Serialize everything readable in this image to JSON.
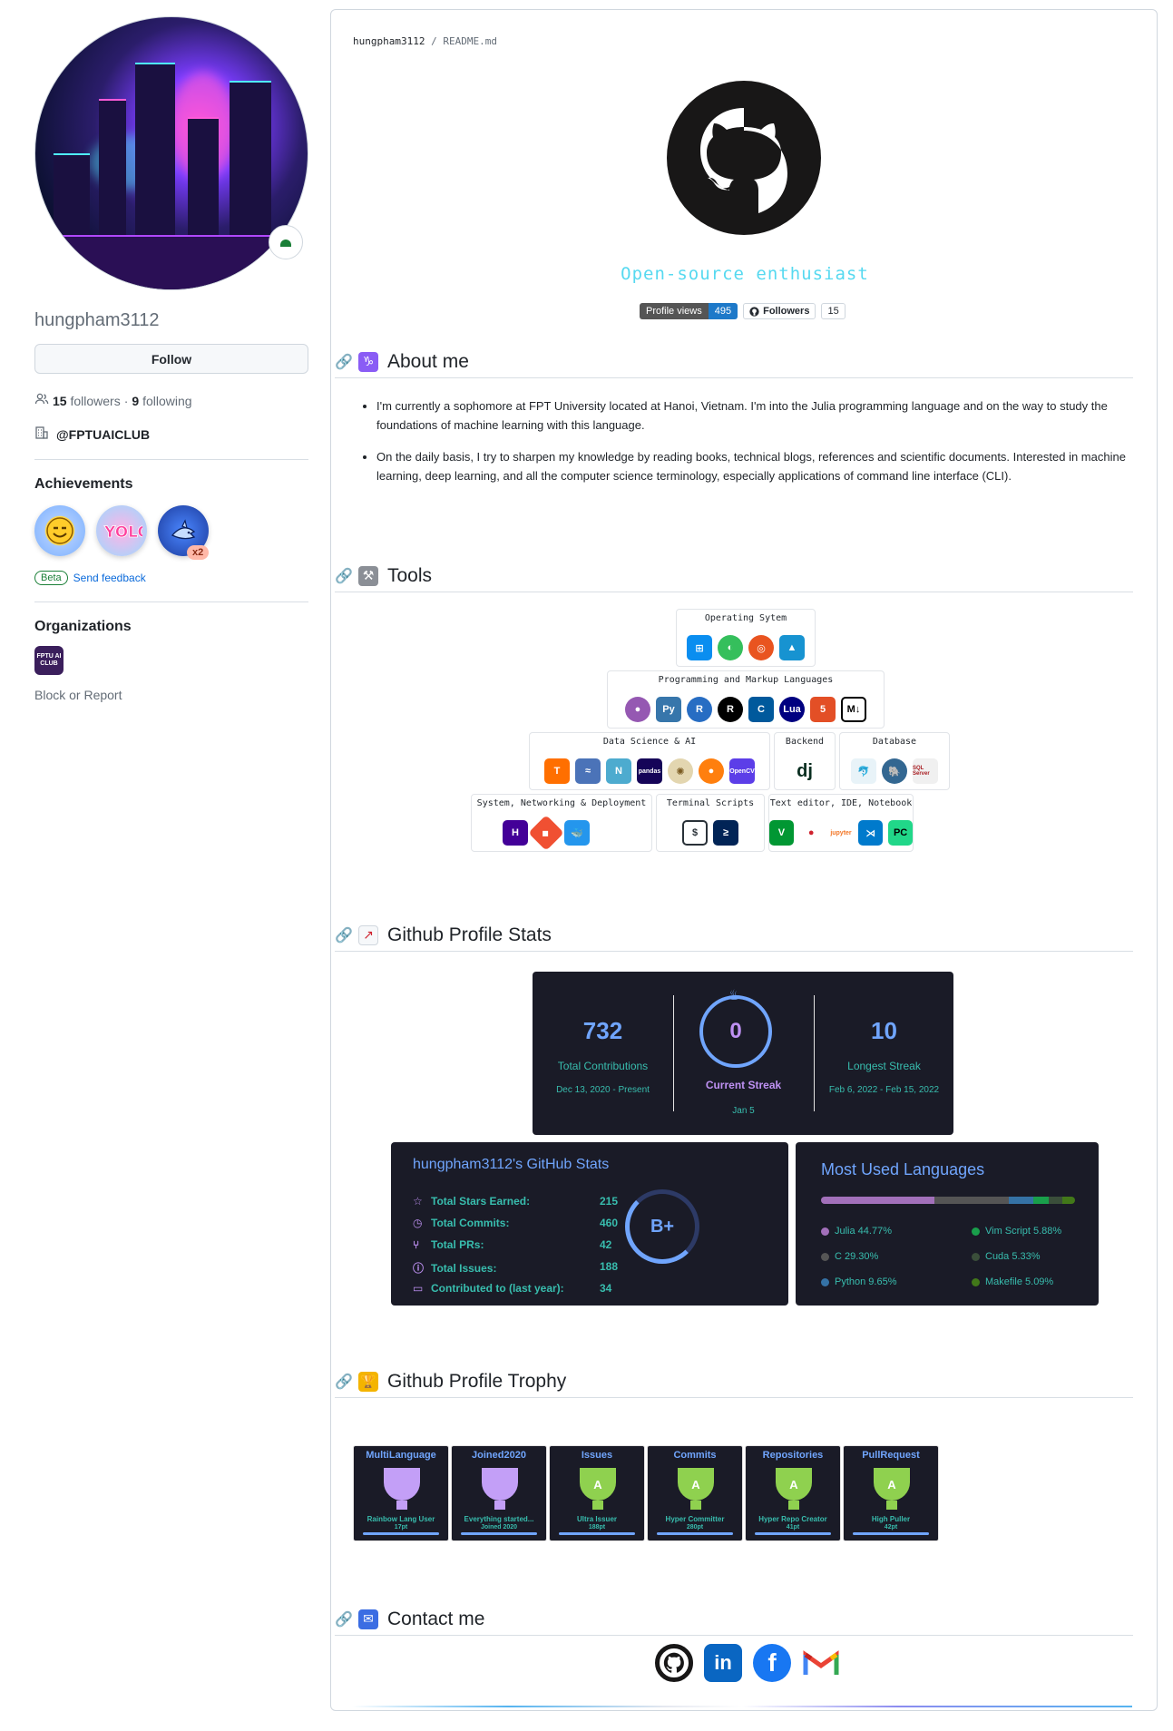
{
  "sidebar": {
    "username": "hungpham3112",
    "follow_label": "Follow",
    "followers_count": "15",
    "followers_label": "followers",
    "following_count": "9",
    "following_label": "following",
    "organization_handle": "@FPTUAICLUB",
    "achievements_title": "Achievements",
    "achievement_multiplier": "x2",
    "beta_label": "Beta",
    "feedback_label": "Send feedback",
    "organizations_title": "Organizations",
    "org_logo_text": "FPTU AI CLUB",
    "block_label": "Block or Report"
  },
  "readme": {
    "breadcrumb_user": "hungpham3112",
    "breadcrumb_sep": " / ",
    "breadcrumb_file": "README.md",
    "tagline": "Open-source enthusiast",
    "profile_views_label": "Profile views",
    "profile_views_value": "495",
    "followers_badge_label": "Followers",
    "followers_badge_value": "15"
  },
  "sections": {
    "about_title": "About me",
    "about_items": [
      "I'm currently a sophomore at FPT University located at Hanoi, Vietnam. I'm into the Julia programming language and on the way to study the foundations of machine learning with this language.",
      "On the daily basis, I try to sharpen my knowledge by reading books, technical blogs, references and scientific documents. Interested in machine learning, deep learning, and all the computer science terminology, especially applications of command line interface (CLI)."
    ],
    "tools_title": "Tools",
    "stats_title": "Github Profile Stats",
    "trophy_title": "Github Profile Trophy",
    "contact_title": "Contact me"
  },
  "tools": {
    "os": "Operating Sytem",
    "langs": "Programming and Markup Languages",
    "ds": "Data Science & AI",
    "backend": "Backend",
    "database": "Database",
    "sys": "System, Networking & Deployment",
    "terminal": "Terminal Scripts",
    "editor": "Text editor, IDE, Notebook",
    "pandas_label": "pandas",
    "opencv_label": "OpenCV",
    "django_label": "dj",
    "jupyter_label": "jupyter",
    "sqlserver_label": "SQL Server"
  },
  "streak": {
    "total": "732",
    "total_label": "Total Contributions",
    "total_range": "Dec 13, 2020 - Present",
    "current": "0",
    "current_label": "Current Streak",
    "current_date": "Jan 5",
    "longest": "10",
    "longest_label": "Longest Streak",
    "longest_range": "Feb 6, 2022 - Feb 15, 2022"
  },
  "stats": {
    "title": "hungpham3112's GitHub Stats",
    "stars_label": "Total Stars Earned:",
    "stars": "215",
    "commits_label": "Total Commits:",
    "commits": "460",
    "prs_label": "Total PRs:",
    "prs": "42",
    "issues_label": "Total Issues:",
    "issues": "188",
    "contrib_label": "Contributed to (last year):",
    "contrib": "34",
    "grade": "B+"
  },
  "languages": {
    "title": "Most Used Languages",
    "items": [
      {
        "name": "Julia 44.77%",
        "color": "#a270ba",
        "pct": 44.77
      },
      {
        "name": "C 29.30%",
        "color": "#555555",
        "pct": 29.3
      },
      {
        "name": "Python 9.65%",
        "color": "#3572a5",
        "pct": 9.65
      },
      {
        "name": "Vim Script 5.88%",
        "color": "#199f4b",
        "pct": 5.88
      },
      {
        "name": "Cuda 5.33%",
        "color": "#3a4e3a",
        "pct": 5.33
      },
      {
        "name": "Makefile 5.09%",
        "color": "#427819",
        "pct": 5.09
      }
    ]
  },
  "trophies": [
    {
      "title": "MultiLanguage",
      "sub": "Rainbow Lang User",
      "pt": "17pt",
      "rank": ""
    },
    {
      "title": "Joined2020",
      "sub": "Everything started...",
      "pt": "Joined 2020",
      "rank": ""
    },
    {
      "title": "Issues",
      "sub": "Ultra Issuer",
      "pt": "188pt",
      "rank": "A"
    },
    {
      "title": "Commits",
      "sub": "Hyper Committer",
      "pt": "280pt",
      "rank": "A"
    },
    {
      "title": "Repositories",
      "sub": "Hyper Repo Creator",
      "pt": "41pt",
      "rank": "A"
    },
    {
      "title": "PullRequest",
      "sub": "High Puller",
      "pt": "42pt",
      "rank": "A"
    }
  ],
  "colors": {
    "accent_blue": "#70a5fd",
    "accent_teal": "#38bdae",
    "accent_purple": "#bf91f3",
    "card_bg": "#1a1b27",
    "link": "#0969da"
  }
}
